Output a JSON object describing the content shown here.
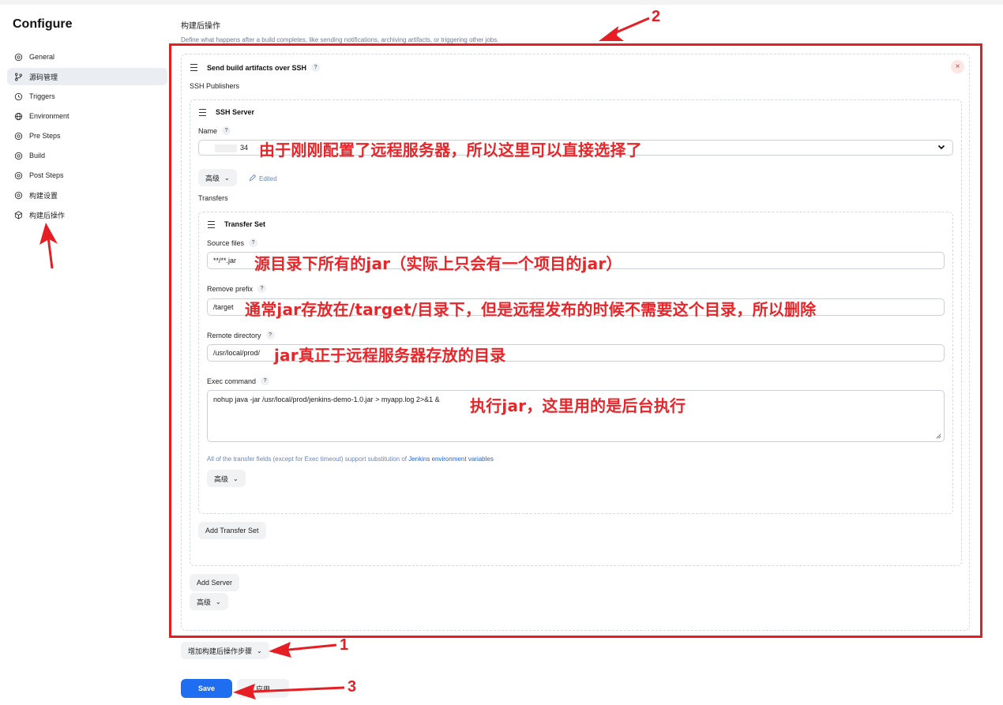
{
  "sidebar": {
    "title": "Configure",
    "items": [
      {
        "label": "General",
        "icon": "gear-icon"
      },
      {
        "label": "源码管理",
        "icon": "branch-icon"
      },
      {
        "label": "Triggers",
        "icon": "clock-icon"
      },
      {
        "label": "Environment",
        "icon": "globe-icon"
      },
      {
        "label": "Pre Steps",
        "icon": "gear-icon"
      },
      {
        "label": "Build",
        "icon": "gear-icon"
      },
      {
        "label": "Post Steps",
        "icon": "gear-icon"
      },
      {
        "label": "构建设置",
        "icon": "gear-icon"
      },
      {
        "label": "构建后操作",
        "icon": "box-icon"
      }
    ]
  },
  "section": {
    "title": "构建后操作",
    "description": "Define what happens after a build completes, like sending notifications, archiving artifacts, or triggering other jobs."
  },
  "publisher": {
    "title": "Send build artifacts over SSH",
    "help": "?",
    "close": "×",
    "publishers_label": "SSH Publishers",
    "server": {
      "title": "SSH Server",
      "name_label": "Name",
      "name_value": "34",
      "advanced_label": "高级",
      "edited_label": "Edited",
      "transfers_label": "Transfers",
      "transfer_set": {
        "title": "Transfer Set",
        "source_files_label": "Source files",
        "source_files_value": "**/**.jar",
        "remove_prefix_label": "Remove prefix",
        "remove_prefix_value": "/target",
        "remote_directory_label": "Remote directory",
        "remote_directory_value": "/usr/local/prod/",
        "exec_command_label": "Exec command",
        "exec_command_value": "nohup java -jar /usr/local/prod/jenkins-demo-1.0.jar > myapp.log 2>&1 &",
        "note_text": "All of the transfer fields (except for Exec timeout) support substitution of ",
        "note_link": "Jenkins environment variables",
        "advanced_label": "高级"
      },
      "add_transfer_set_label": "Add Transfer Set"
    },
    "add_server_label": "Add Server",
    "advanced_label": "高级"
  },
  "add_step_label": "增加构建后操作步骤",
  "save_label": "Save",
  "apply_label": "应用",
  "annotations": {
    "name": "由于刚刚配置了远程服务器，所以这里可以直接选择了",
    "source": "源目录下所有的jar（实际上只会有一个项目的jar）",
    "prefix": "通常jar存放在/target/目录下，但是远程发布的时候不需要这个目录，所以删除",
    "remote": "jar真正于远程服务器存放的目录",
    "exec": "执行jar，这里用的是后台执行",
    "num1": "1",
    "num2": "2",
    "num3": "3"
  },
  "colors": {
    "annotation_red": "#e61e23",
    "primary_blue": "#1f6df0"
  }
}
